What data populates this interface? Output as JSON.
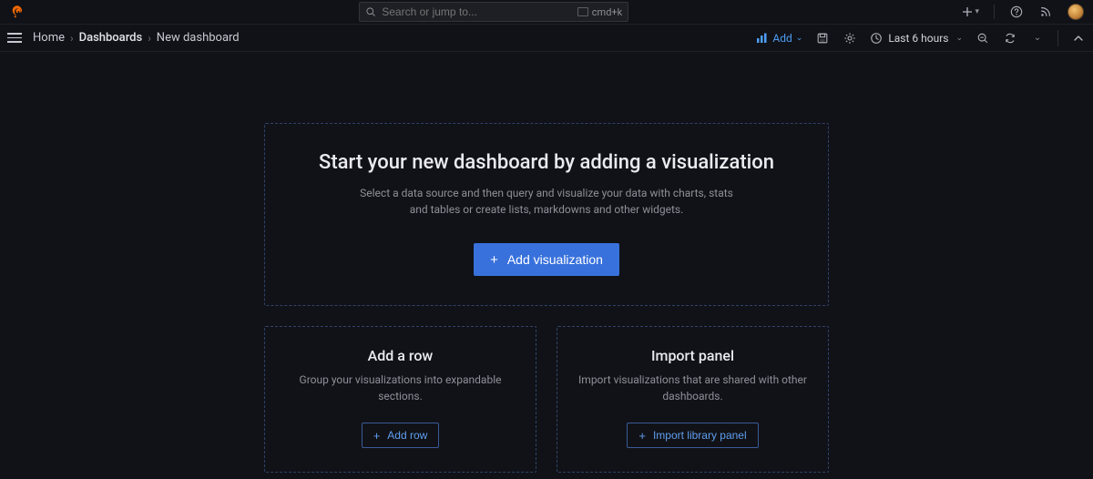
{
  "search": {
    "placeholder": "Search or jump to...",
    "shortcut": "cmd+k"
  },
  "breadcrumbs": {
    "home": "Home",
    "dashboards": "Dashboards",
    "current": "New dashboard"
  },
  "toolbar": {
    "add_label": "Add",
    "time_label": "Last 6 hours"
  },
  "main_card": {
    "title": "Start your new dashboard by adding a visualization",
    "subtitle": "Select a data source and then query and visualize your data with charts, stats and tables or create lists, markdowns and other widgets.",
    "button": "Add visualization"
  },
  "row_card": {
    "title": "Add a row",
    "subtitle": "Group your visualizations into expandable sections.",
    "button": "Add row"
  },
  "import_card": {
    "title": "Import panel",
    "subtitle": "Import visualizations that are shared with other dashboards.",
    "button": "Import library panel"
  }
}
